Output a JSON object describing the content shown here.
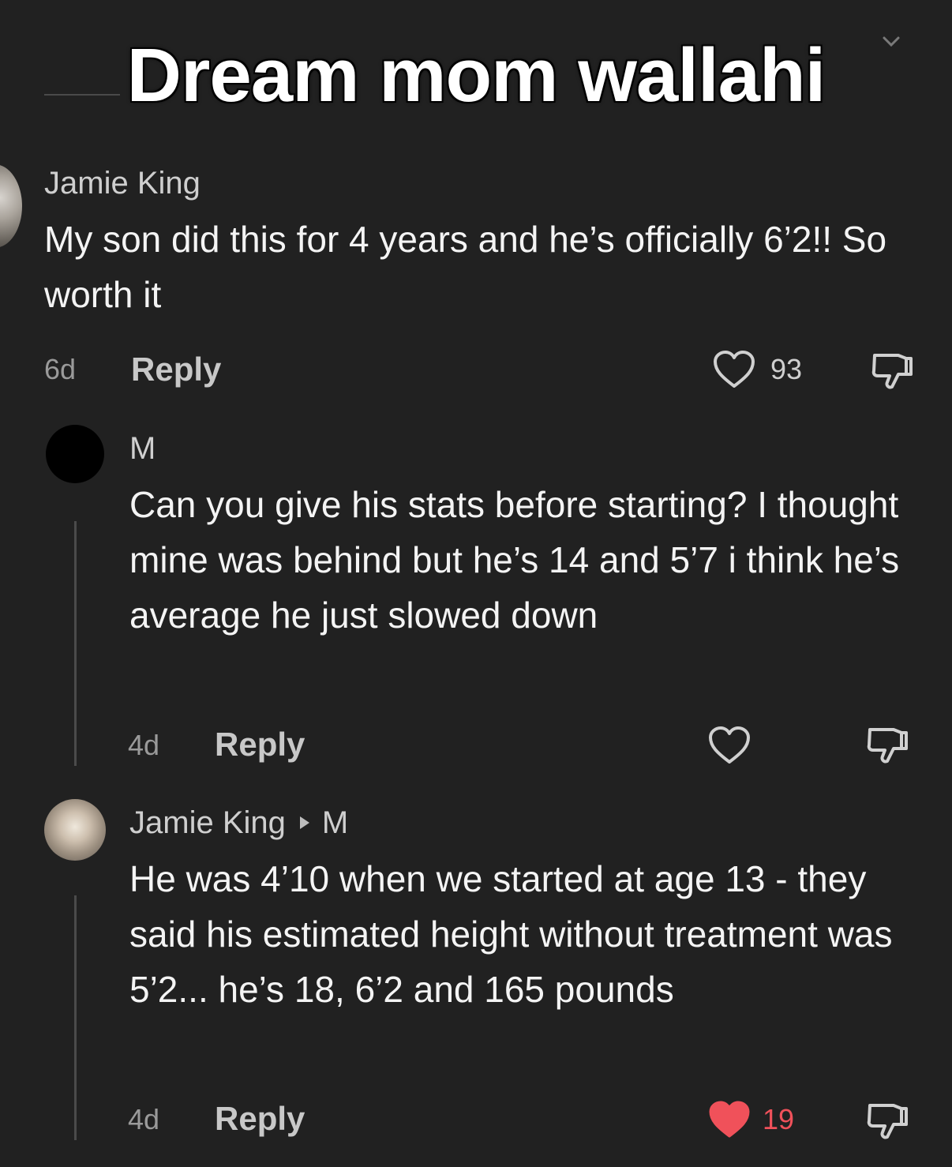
{
  "caption": "Dream mom wallahi",
  "comments": [
    {
      "username": "Jamie King",
      "text": "My son did this for 4 years and he’s officially 6’2!! So worth it",
      "time": "6d",
      "reply_label": "Reply",
      "likes": "93",
      "liked": false
    },
    {
      "username": "M",
      "text": "Can you give his stats before starting? I thought mine was behind but he’s 14 and 5’7 i think he’s average he just slowed down",
      "time": "4d",
      "reply_label": "Reply",
      "likes": "",
      "liked": false
    },
    {
      "username": "Jamie King",
      "reply_to": "M",
      "text": "He was 4’10 when we started at age 13 - they said his estimated height without treatment was 5’2... he’s 18, 6’2 and 165 pounds",
      "time": "4d",
      "reply_label": "Reply",
      "likes": "19",
      "liked": true
    }
  ],
  "colors": {
    "background": "#212121",
    "liked_heart": "#f0515a",
    "thread_line": "#4b4b4b"
  },
  "icons": [
    "heart-icon",
    "heart-filled-icon",
    "dislike-icon",
    "chevron-down-icon",
    "reply-to-arrow-icon"
  ]
}
